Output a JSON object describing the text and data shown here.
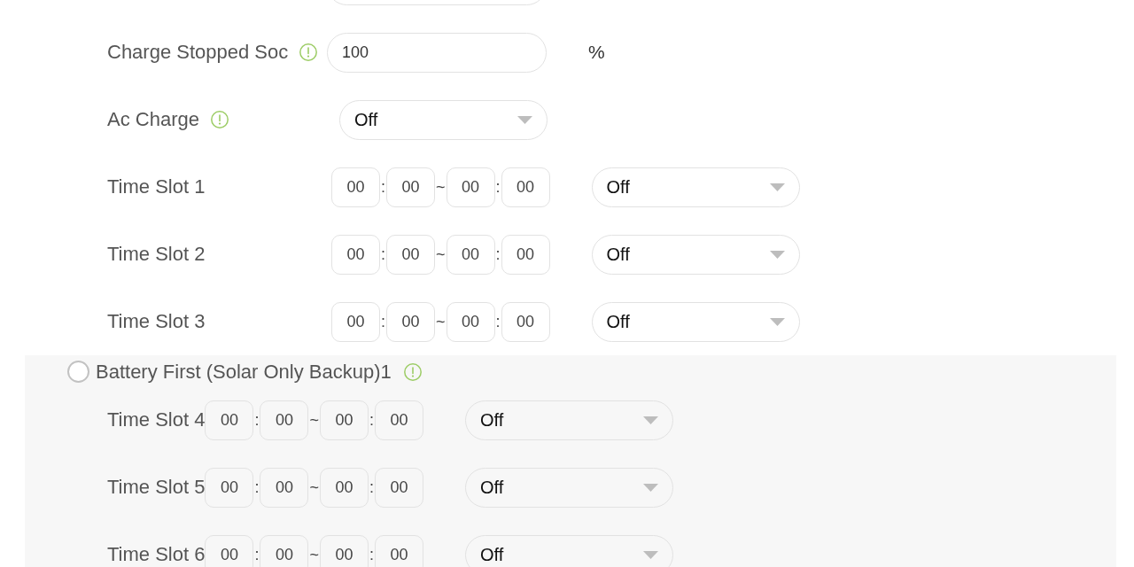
{
  "sections": [
    {
      "kind": "plain",
      "rows": [
        {
          "kind": "input"
        },
        {
          "kind": "input",
          "label": "Charge Stopped Soc",
          "info": true,
          "value": "100",
          "unit": "%"
        },
        {
          "kind": "select",
          "label": "Ac Charge",
          "info": true,
          "value": "Off"
        },
        {
          "kind": "time_slot",
          "label": "Time Slot 1",
          "fields": [
            "00",
            "00",
            "00",
            "00"
          ],
          "separators": [
            ":",
            "~",
            ":"
          ],
          "value": "Off"
        },
        {
          "kind": "time_slot",
          "label": "Time Slot 2",
          "fields": [
            "00",
            "00",
            "00",
            "00"
          ],
          "separators": [
            ":",
            "~",
            ":"
          ],
          "value": "Off"
        },
        {
          "kind": "time_slot",
          "label": "Time Slot 3",
          "fields": [
            "00",
            "00",
            "00",
            "00"
          ],
          "separators": [
            ":",
            "~",
            ":"
          ],
          "value": "Off"
        }
      ]
    },
    {
      "kind": "panel",
      "option": {
        "label": "Battery First (Solar Only Backup)1",
        "selected": false,
        "info": true
      },
      "rows": [
        {
          "kind": "time_slot",
          "label": "Time Slot 4",
          "fields": [
            "00",
            "00",
            "00",
            "00"
          ],
          "separators": [
            ":",
            "~",
            ":"
          ],
          "value": "Off"
        },
        {
          "kind": "time_slot",
          "label": "Time Slot 5",
          "fields": [
            "00",
            "00",
            "00",
            "00"
          ],
          "separators": [
            ":",
            "~",
            ":"
          ],
          "value": "Off"
        },
        {
          "kind": "time_slot",
          "label": "Time Slot 6",
          "fields": [
            "00",
            "00",
            "00",
            "00"
          ],
          "separators": [
            ":",
            "~",
            ":"
          ],
          "value": "Off"
        }
      ]
    }
  ]
}
